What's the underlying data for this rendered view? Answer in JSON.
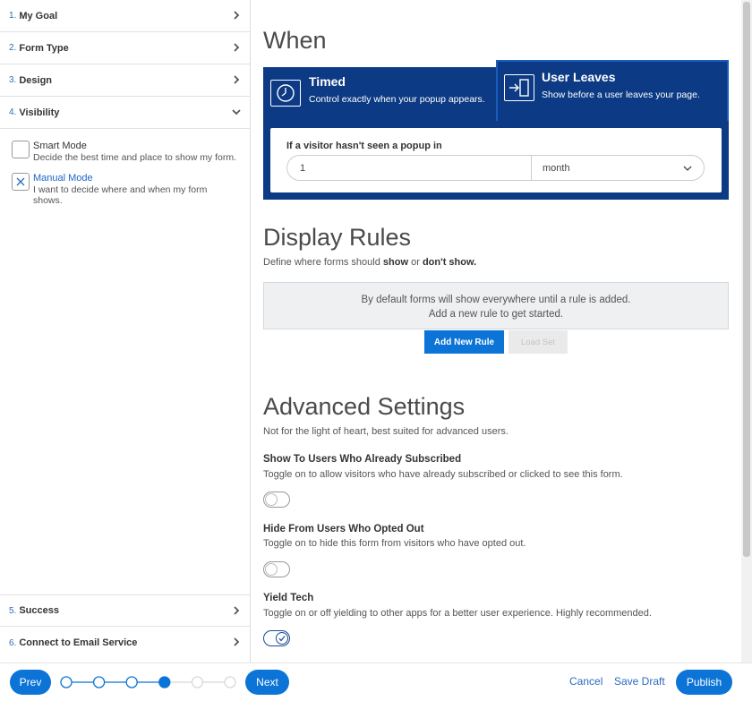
{
  "sidebar": {
    "steps": [
      {
        "num": "1.",
        "label": "My Goal"
      },
      {
        "num": "2.",
        "label": "Form Type"
      },
      {
        "num": "3.",
        "label": "Design"
      },
      {
        "num": "4.",
        "label": "Visibility"
      },
      {
        "num": "5.",
        "label": "Success"
      },
      {
        "num": "6.",
        "label": "Connect to Email Service"
      }
    ],
    "modes": [
      {
        "title": "Smart Mode",
        "desc": "Decide the best time and place to show my form.",
        "checked": false
      },
      {
        "title": "Manual Mode",
        "desc": "I want to decide where and when my form shows.",
        "checked": true
      }
    ]
  },
  "when": {
    "heading": "When",
    "tabs": [
      {
        "title": "Timed",
        "desc": "Control exactly when your popup appears.",
        "icon": "clock-icon",
        "selected": false
      },
      {
        "title": "User Leaves",
        "desc": "Show before a user leaves your page.",
        "icon": "exit-door-icon",
        "selected": true
      }
    ],
    "question": "If a visitor hasn't seen a popup in",
    "amount": "1",
    "unit": "month"
  },
  "display_rules": {
    "heading": "Display Rules",
    "sub_prefix": "Define where forms should ",
    "sub_show": "show",
    "sub_or": " or ",
    "sub_dont": "don't show.",
    "empty_line1": "By default forms will show everywhere until a rule is added.",
    "empty_line2": "Add a new rule to get started.",
    "add_label": "Add New Rule",
    "load_label": "Load Set"
  },
  "advanced": {
    "heading": "Advanced Settings",
    "sub": "Not for the light of heart, best suited for advanced users.",
    "settings": [
      {
        "title": "Show To Users Who Already Subscribed",
        "desc": "Toggle on to allow visitors who have already subscribed or clicked to see this form.",
        "on": false
      },
      {
        "title": "Hide From Users Who Opted Out",
        "desc": "Toggle on to hide this form from visitors who have opted out.",
        "on": false
      },
      {
        "title": "Yield Tech",
        "desc": "Toggle on or off yielding to other apps for a better user experience. Highly recommended.",
        "on": true
      }
    ]
  },
  "footer": {
    "prev": "Prev",
    "next": "Next",
    "cancel": "Cancel",
    "save_draft": "Save Draft",
    "publish": "Publish",
    "progress_total": 6,
    "progress_current": 4
  },
  "colors": {
    "accent": "#0b74d6",
    "panel": "#0c3a84",
    "link": "#2a6bbf"
  }
}
